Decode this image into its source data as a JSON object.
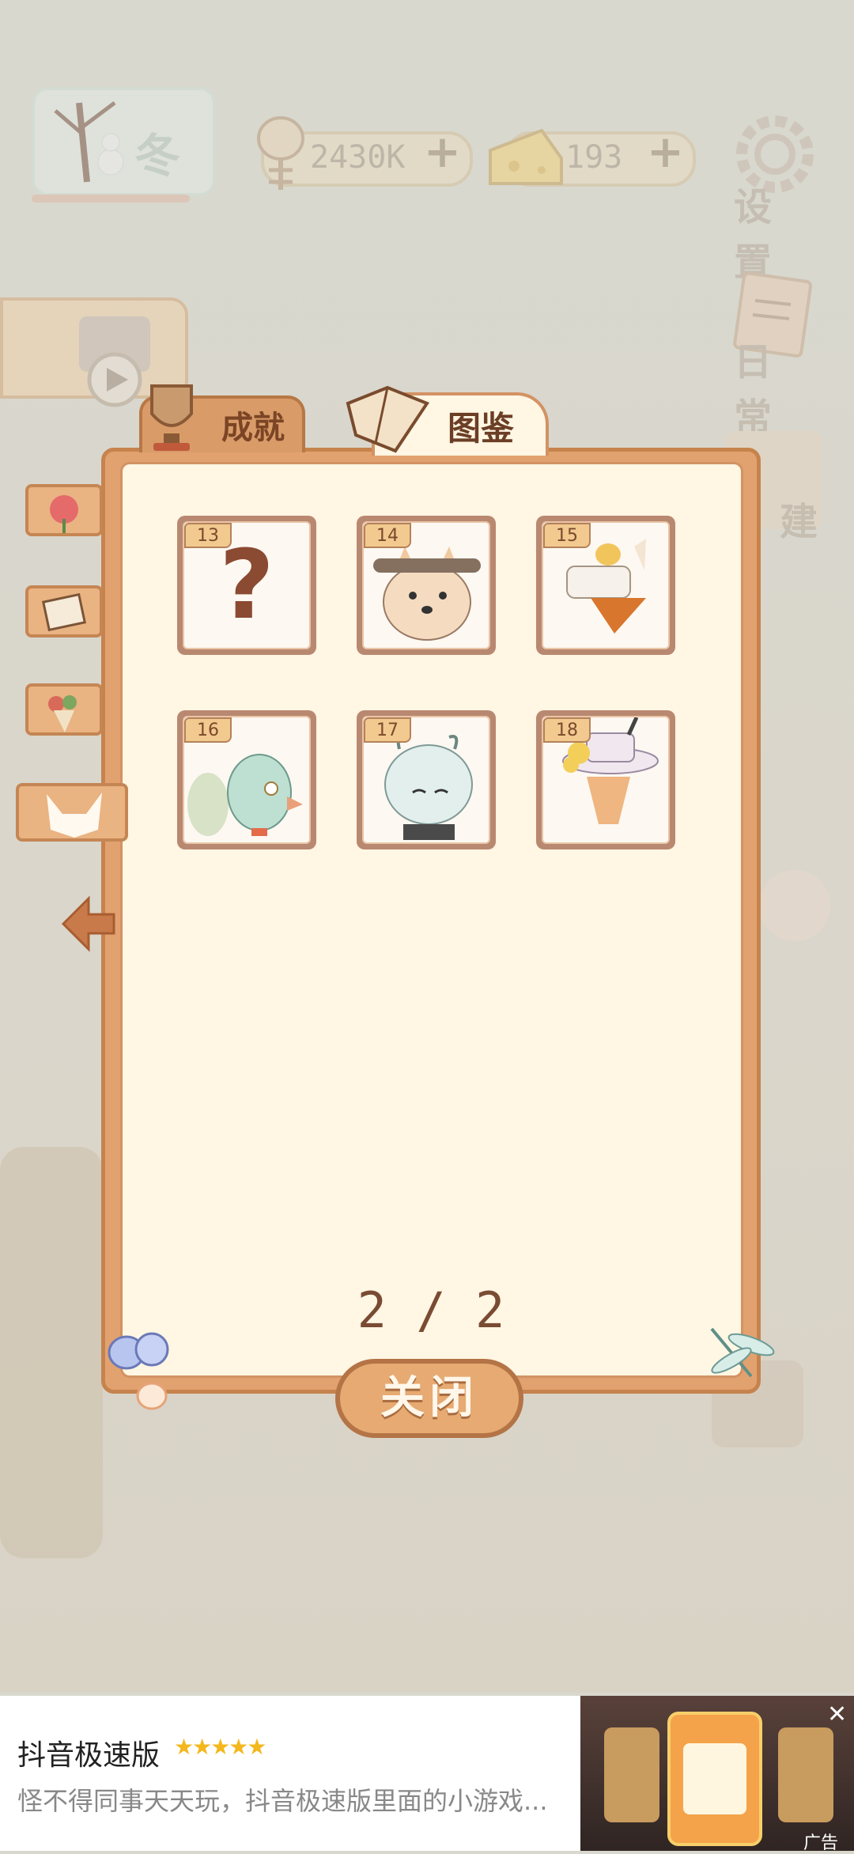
{
  "topbar": {
    "season": "冬",
    "currency_fish": "2430K",
    "currency_cheese": "193",
    "plus": "+",
    "settings_label": "设置",
    "daily_label": "日常",
    "build_label": "建"
  },
  "dialog": {
    "tab_achievement": "成就",
    "tab_collection": "图鉴",
    "cards": [
      {
        "num": "13",
        "locked": true,
        "mark": "?"
      },
      {
        "num": "14",
        "locked": false,
        "icon": "shiba-dog-icon"
      },
      {
        "num": "15",
        "locked": false,
        "icon": "chicken-hat-fox-icon"
      },
      {
        "num": "16",
        "locked": false,
        "icon": "peacock-icon"
      },
      {
        "num": "17",
        "locked": false,
        "icon": "dragon-boy-icon"
      },
      {
        "num": "18",
        "locked": false,
        "icon": "antelope-hat-icon"
      }
    ],
    "page_indicator": "2 / 2",
    "close_label": "关闭"
  },
  "ad": {
    "title": "抖音极速版",
    "stars": "★★★★★",
    "description": "怪不得同事天天玩，抖音极速版里面的小游戏...",
    "close": "✕",
    "tag": "广告"
  }
}
